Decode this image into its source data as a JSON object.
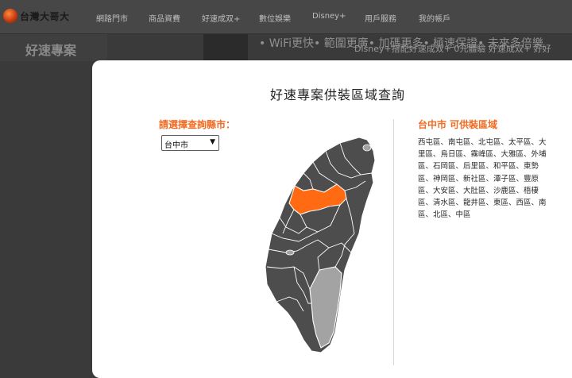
{
  "header": {
    "logo_text": "台灣大哥大",
    "nav": [
      "網路門市",
      "商品資費",
      "好速成双+",
      "數位娛樂",
      "Disney+",
      "用戶服務",
      "我的帳戶"
    ]
  },
  "background": {
    "banner_title": "好速專案",
    "ticker_text": "•  WiFi更快•  範圍更廣•  加碼更多•  極速保證•  未來多倍樂",
    "sub_ticker_text": "Disney+搭配好速成双+     0元體驗     好速成双+     好好"
  },
  "modal": {
    "title": "好速專案供裝區域查詢",
    "select_label": "請選擇查詢縣市：",
    "selected_city": "台中市",
    "area_title": "台中市 可供裝區域",
    "areas": "西屯區、南屯區、北屯區、太平區、大里區、烏日區、霧峰區、大雅區、外埔區、石岡區、后里區、和平區、東勢區、神岡區、新社區、潭子區、豐原區、大安區、大肚區、沙鹿區、梧棲區、清水區、龍井區、東區、西區、南區、北區、中區"
  },
  "colors": {
    "accent": "#f26b23",
    "highlight_region": "#ff6a13",
    "map_dark": "#4d4d4d",
    "map_light": "#a3a3a3"
  }
}
